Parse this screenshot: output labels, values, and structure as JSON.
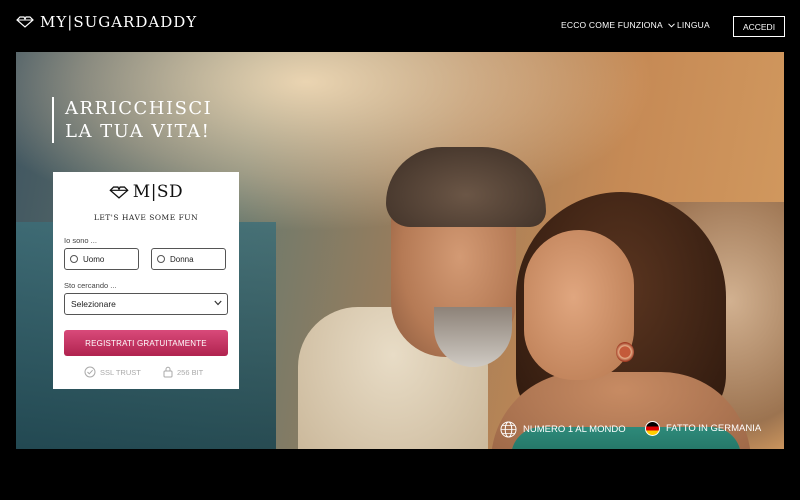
{
  "header": {
    "logo_text": "MY|SUGARDADDY",
    "nav_how": "ECCO COME FUNZIONA",
    "nav_language": "LINGUA",
    "login_label": "ACCEDI"
  },
  "hero": {
    "tagline_line1": "ARRICCHISCI",
    "tagline_line2": "LA TUA VITA!"
  },
  "signup_card": {
    "logo_text": "M|SD",
    "slogan": "LET'S HAVE SOME FUN",
    "i_am_label": "Io sono ...",
    "option_man": "Uomo",
    "option_woman": "Donna",
    "seeking_label": "Sto cercando ...",
    "select_value": "Selezionare",
    "register_label": "REGISTRATI GRATUITAMENTE",
    "trust_ssl": "SSL TRUST",
    "trust_bit": "256 BIT"
  },
  "features": {
    "world": "NUMERO 1 AL MONDO",
    "germany": "FATTO IN GERMANIA"
  },
  "colors": {
    "register_button": "#c2305f",
    "background": "#000000"
  },
  "icons": [
    "diamond-logo-icon",
    "chevron-down-icon",
    "radio-icon",
    "check-circle-icon",
    "lock-icon",
    "globe-icon",
    "germany-flag-icon"
  ]
}
